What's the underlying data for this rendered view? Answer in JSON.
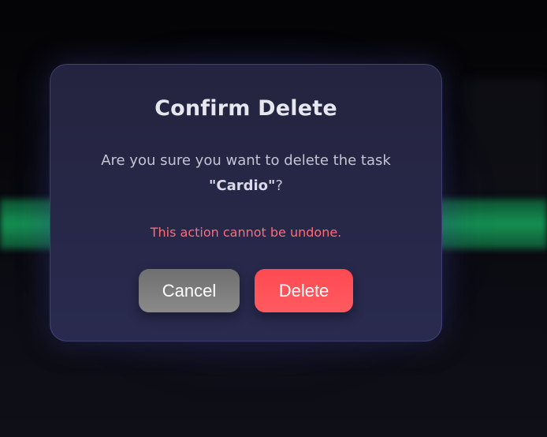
{
  "dialog": {
    "title": "Confirm Delete",
    "message_prefix": "Are you sure you want to delete the task ",
    "task_name_quoted": "\"Cardio\"",
    "message_suffix": "?",
    "warning": "This action cannot be undone.",
    "cancel_label": "Cancel",
    "delete_label": "Delete"
  },
  "colors": {
    "accent_danger": "#ff4a52",
    "warning_text": "#ff6b78",
    "cancel_button": "#7c7c7c",
    "modal_background": "#282848",
    "background_highlight": "#16aa5f"
  }
}
